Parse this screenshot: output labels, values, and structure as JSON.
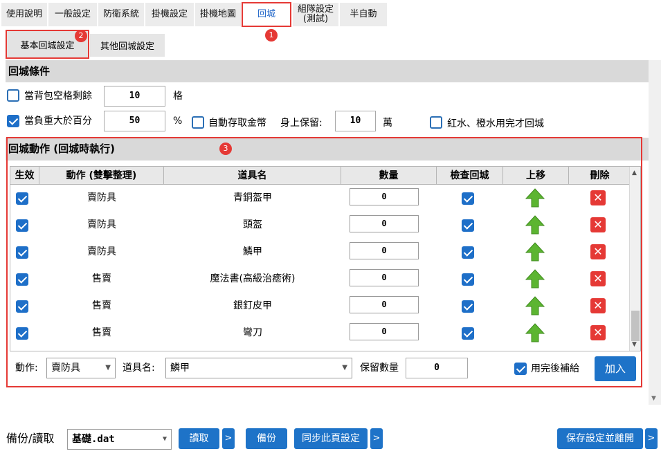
{
  "tabs": [
    {
      "label": "使用說明"
    },
    {
      "label": "一般設定"
    },
    {
      "label": "防衛系統"
    },
    {
      "label": "掛機設定"
    },
    {
      "label": "掛機地圖"
    },
    {
      "label": "回城"
    },
    {
      "label_line1": "組隊設定",
      "label_line2": "(測試)"
    },
    {
      "label": "半自動"
    }
  ],
  "subtabs": [
    {
      "label": "基本回城設定"
    },
    {
      "label": "其他回城設定"
    }
  ],
  "badges": [
    "1",
    "2",
    "3"
  ],
  "conditions": {
    "header": "回城條件",
    "bag_label": "當背包空格剩餘",
    "bag_value": "10",
    "bag_unit": "格",
    "weight_label": "當負重大於百分",
    "weight_value": "50",
    "weight_unit": "%",
    "auto_gold_label": "自動存取金幣",
    "keep_label": "身上保留:",
    "keep_value": "10",
    "keep_unit": "萬",
    "potion_label": "紅水、橙水用完才回城"
  },
  "actions": {
    "header": "回城動作 (回城時執行)",
    "columns": [
      "生效",
      "動作 (雙擊整理)",
      "道具名",
      "數量",
      "檢查回城",
      "上移",
      "刪除"
    ],
    "rows": [
      {
        "action": "賣防具",
        "item": "青銅盔甲",
        "qty": "0"
      },
      {
        "action": "賣防具",
        "item": "頭盔",
        "qty": "0"
      },
      {
        "action": "賣防具",
        "item": "鱗甲",
        "qty": "0"
      },
      {
        "action": "售賣",
        "item": "魔法書(高級治癒術)",
        "qty": "0"
      },
      {
        "action": "售賣",
        "item": "銀釘皮甲",
        "qty": "0"
      },
      {
        "action": "售賣",
        "item": "彎刀",
        "qty": "0"
      }
    ],
    "form": {
      "action_label": "動作:",
      "action_value": "賣防具",
      "item_label": "道具名:",
      "item_value": "鱗甲",
      "keep_label": "保留數量",
      "keep_value": "0",
      "refill_label": "用完後補給",
      "add_button": "加入"
    }
  },
  "footer": {
    "backup_label": "備份/讀取",
    "file_value": "基礎.dat",
    "read_button": "讀取",
    "backup_button": "備份",
    "sync_button": "同步此頁設定",
    "save_exit_button": "保存設定並離開",
    "more": ">"
  },
  "colors": {
    "accent": "#1e73c8",
    "highlight": "#e53935",
    "up_arrow": "#5cb531"
  }
}
